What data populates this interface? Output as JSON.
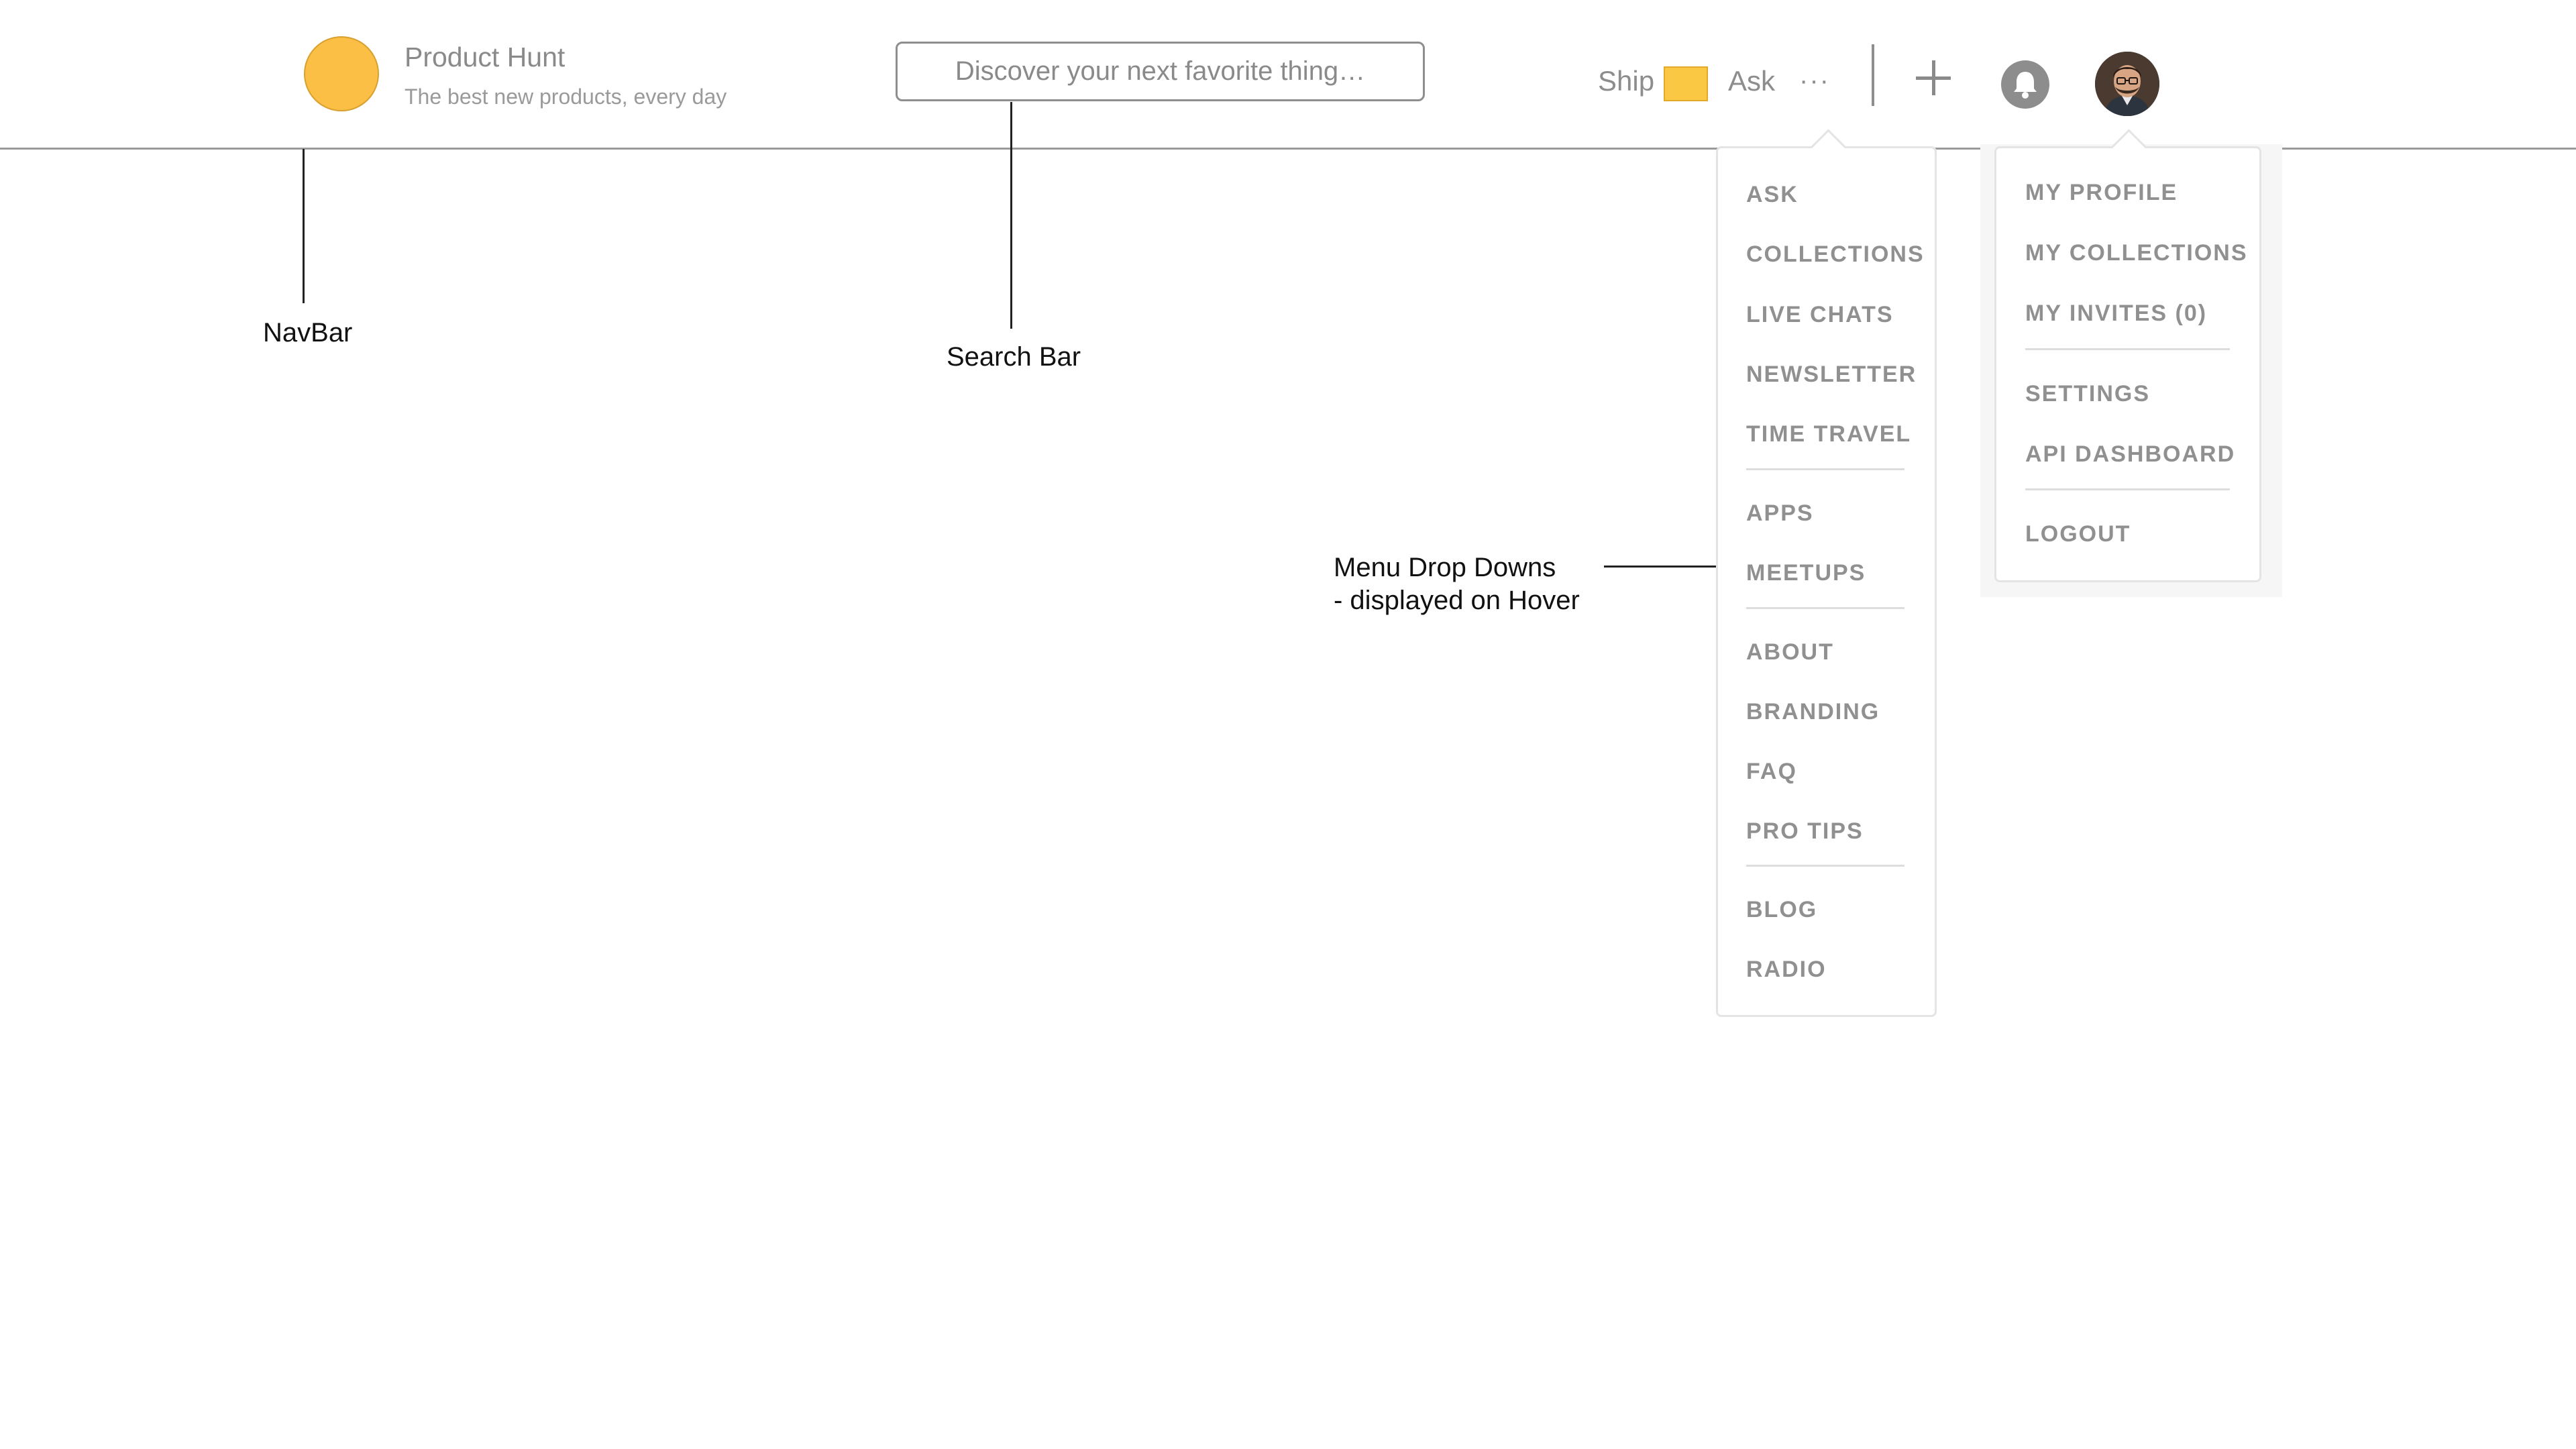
{
  "header": {
    "brand": {
      "title": "Product Hunt",
      "tagline": "The best new products, every day",
      "logo_color": "#fbbf46"
    },
    "search": {
      "placeholder": "Discover your next favorite thing…"
    },
    "nav": {
      "ship_label": "Ship",
      "ship_swatch_color": "#fbc843",
      "ask_label": "Ask",
      "more_label": "···"
    },
    "icons": {
      "plus": "plus-icon",
      "bell": "bell-icon",
      "avatar": "avatar"
    }
  },
  "annotations": {
    "navbar": "NavBar",
    "search_bar": "Search Bar",
    "menus_line1": "Menu Drop Downs",
    "menus_line2": "- displayed on Hover"
  },
  "menus": {
    "main": {
      "items": [
        "ASK",
        "COLLECTIONS",
        "LIVE CHATS",
        "NEWSLETTER",
        "TIME TRAVEL",
        "APPS",
        "MEETUPS",
        "ABOUT",
        "BRANDING",
        "FAQ",
        "PRO TIPS",
        "BLOG",
        "RADIO"
      ]
    },
    "user": {
      "items": [
        "MY PROFILE",
        "MY COLLECTIONS",
        "MY INVITES (0)",
        "SETTINGS",
        "API DASHBOARD",
        "LOGOUT"
      ]
    }
  }
}
